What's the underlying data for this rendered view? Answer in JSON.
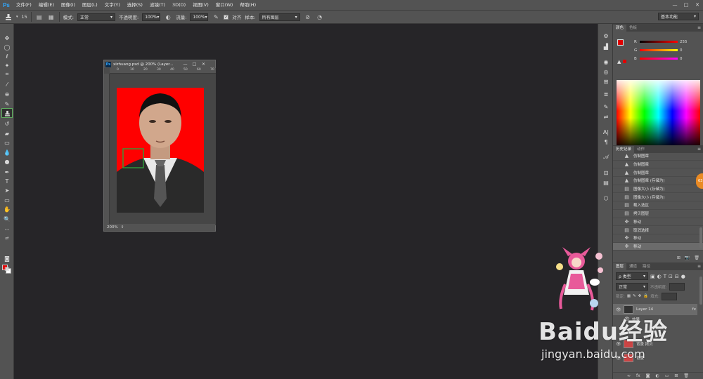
{
  "app": {
    "logo": "Ps",
    "accent": "#31a8ff"
  },
  "menu": [
    "文件(F)",
    "编辑(E)",
    "图像(I)",
    "图层(L)",
    "文字(Y)",
    "选择(S)",
    "滤镜(T)",
    "3D(D)",
    "视图(V)",
    "窗口(W)",
    "帮助(H)"
  ],
  "window_controls": {
    "minimize": "—",
    "maximize": "□",
    "close": "✕"
  },
  "options": {
    "brush_size": "15",
    "mode_label": "模式:",
    "mode_value": "正常",
    "opacity_label": "不透明度:",
    "opacity_value": "100%",
    "flow_label": "流量:",
    "flow_value": "100%",
    "aligned_label": "对齐",
    "sample_label": "样本:",
    "sample_value": "所有图层",
    "workspace": "基本功能"
  },
  "document": {
    "title": "xizhuang.psd @ 200% (Layer...",
    "zoom": "200%",
    "ruler_top": [
      "0",
      "10",
      "20",
      "30",
      "40",
      "50",
      "60",
      "70"
    ],
    "photo_bg": "#ff0000"
  },
  "colors": {
    "foreground": "#e00000",
    "background": "#ffffff"
  },
  "color_panel": {
    "tabs": [
      "颜色",
      "色板"
    ],
    "sliders": [
      {
        "letter": "R",
        "value": "255"
      },
      {
        "letter": "G",
        "value": "0"
      },
      {
        "letter": "B",
        "value": "0"
      }
    ]
  },
  "history_panel": {
    "tabs": [
      "历史记录",
      "动作"
    ],
    "items": [
      {
        "icon": "stamp-icon",
        "label": "仿制图章",
        "selected": false
      },
      {
        "icon": "stamp-icon",
        "label": "仿制图章",
        "selected": false
      },
      {
        "icon": "stamp-icon",
        "label": "仿制图章",
        "selected": false
      },
      {
        "icon": "stamp-icon",
        "label": "仿制图章 (存储为)",
        "selected": false
      },
      {
        "icon": "document-icon",
        "label": "图像大小 (存储为)",
        "selected": false
      },
      {
        "icon": "document-icon",
        "label": "图像大小 (存储为)",
        "selected": false
      },
      {
        "icon": "document-icon",
        "label": "载入选区",
        "selected": false
      },
      {
        "icon": "document-icon",
        "label": "拷贝图层",
        "selected": false
      },
      {
        "icon": "move-icon",
        "label": "移动",
        "selected": false
      },
      {
        "icon": "document-icon",
        "label": "取消选择",
        "selected": false
      },
      {
        "icon": "move-icon",
        "label": "移动",
        "selected": false
      },
      {
        "icon": "move-icon",
        "label": "移动",
        "selected": true
      }
    ]
  },
  "layers_panel": {
    "tabs": [
      "图层",
      "通道",
      "路径"
    ],
    "filter_label": "ρ 类型",
    "blend_mode": "正常",
    "opacity_label": "不透明度:",
    "lock_label": "锁定:",
    "fill_label": "填充:",
    "layers": [
      {
        "name": "Layer 14",
        "fx": "fx"
      },
      {
        "name": "效果"
      },
      {
        "name": "背景 拷贝"
      },
      {
        "name": "背景"
      }
    ]
  },
  "overlays": {
    "orange_btn": "63",
    "watermark_main": "Baidu经验",
    "watermark_url": "jingyan.baidu.com"
  }
}
